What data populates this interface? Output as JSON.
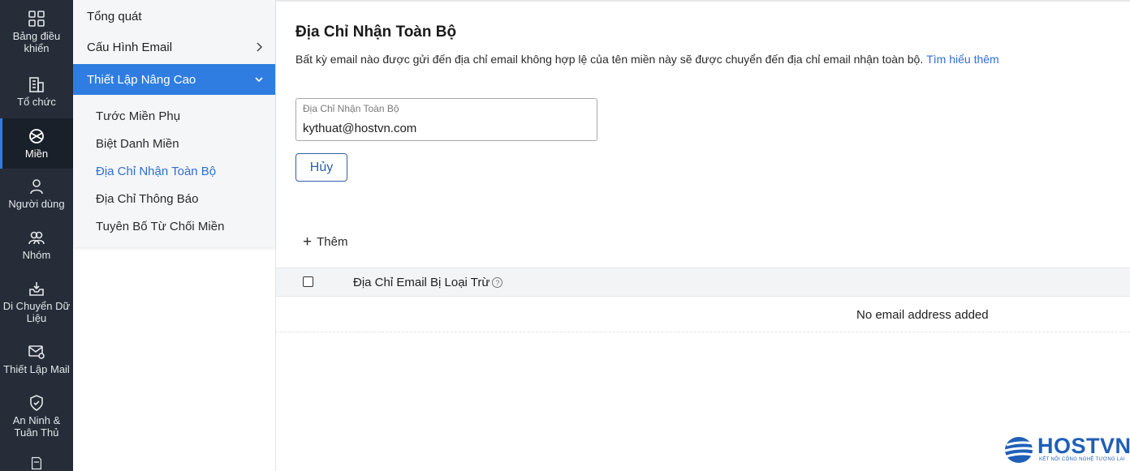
{
  "rail": {
    "items": [
      {
        "label": "Bảng điều khiển"
      },
      {
        "label": "Tổ chức"
      },
      {
        "label": "Miền"
      },
      {
        "label": "Người dùng"
      },
      {
        "label": "Nhóm"
      },
      {
        "label": "Di Chuyển Dữ Liệu"
      },
      {
        "label": "Thiết Lập Mail"
      },
      {
        "label": "An Ninh & Tuân Thủ"
      }
    ],
    "active_index": 2
  },
  "subnav": {
    "items": [
      {
        "label": "Tổng quát"
      },
      {
        "label": "Cấu Hình Email"
      },
      {
        "label": "Thiết Lập Nâng Cao"
      }
    ],
    "expanded_children": [
      {
        "label": "Tước Miền Phụ"
      },
      {
        "label": "Biệt Danh Miền"
      },
      {
        "label": "Địa Chỉ Nhận Toàn Bộ"
      },
      {
        "label": "Địa Chỉ Thông Báo"
      },
      {
        "label": "Tuyên Bố Từ Chối Miền"
      }
    ],
    "current_child": "Địa Chỉ Nhận Toàn Bộ"
  },
  "main": {
    "title": "Địa Chỉ Nhận Toàn Bộ",
    "description": "Bất kỳ email nào được gửi đến địa chỉ email không hợp lệ của tên miền này sẽ được chuyển đến địa chỉ email nhận toàn bộ.",
    "learn_more": "Tìm hiểu thêm",
    "field_label": "Địa Chỉ Nhận Toàn Bộ",
    "field_value": "kythuat@hostvn.com",
    "cancel_label": "Hủy",
    "add_label": "Thêm",
    "table_header": "Địa Chỉ Email Bị Loại Trừ",
    "help_glyph": "?",
    "empty_text": "No email address added"
  },
  "logo": {
    "word": "HOSTVN",
    "tagline": "KẾT NỐI CÔNG NGHỆ TƯƠNG LAI",
    "color": "#1f5fb8"
  },
  "colors": {
    "rail_bg": "#262d38",
    "accent": "#2f7de1",
    "link": "#2f6fd3"
  }
}
